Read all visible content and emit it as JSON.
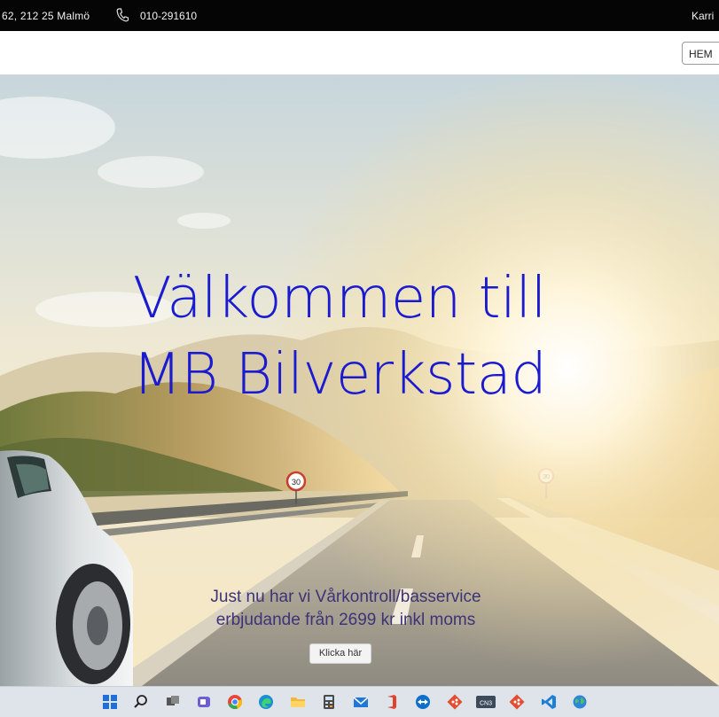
{
  "topbar": {
    "address": "62, 212 25 Malmö",
    "phone_icon": "phone-icon",
    "phone": "010-291610",
    "right_text": "Karri"
  },
  "navbar": {
    "menu_label": "HEM"
  },
  "hero": {
    "title_line1": "Välkommen till",
    "title_line2": "MB Bilverkstad",
    "offer_line1": "Just nu har vi Vårkontroll/basservice",
    "offer_line2": "erbjudande från 2699 kr inkl moms",
    "cta_label": "Klicka här",
    "sign_left": "30",
    "sign_right": "30"
  },
  "taskbar": {
    "icons": [
      "windows-start-icon",
      "search-icon",
      "task-view-icon",
      "teams-icon",
      "chrome-icon",
      "edge-icon",
      "file-explorer-icon",
      "calculator-icon",
      "mail-icon",
      "office-icon",
      "teamviewer-icon",
      "git-icon",
      "cn3-app-icon",
      "git-icon",
      "vscode-icon",
      "globe-icon"
    ],
    "cn3_label": "CN3"
  },
  "colors": {
    "title": "#1a1ad0",
    "offer": "#3d3378",
    "topbar": "#050505"
  }
}
